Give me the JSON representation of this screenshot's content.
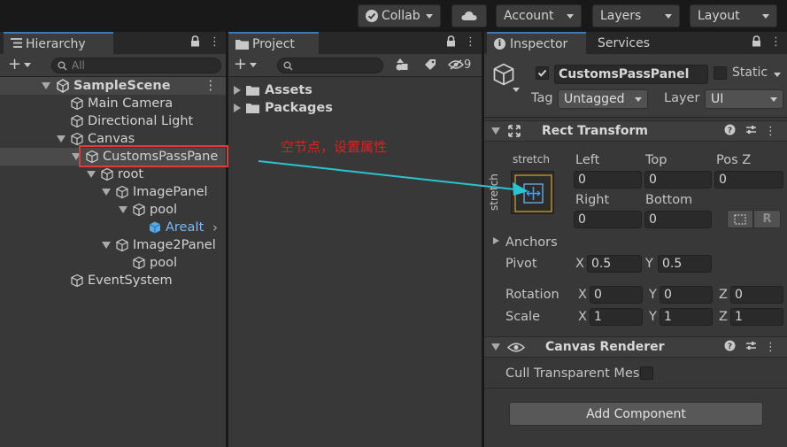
{
  "toolbar": {
    "collab_label": "Collab",
    "account_label": "Account",
    "layers_label": "Layers",
    "layout_label": "Layout"
  },
  "hierarchy": {
    "tab_label": "Hierarchy",
    "search_placeholder": "All",
    "scene_name": "SampleScene",
    "items": [
      {
        "label": "Main Camera"
      },
      {
        "label": "Directional Light"
      },
      {
        "label": "Canvas"
      },
      {
        "label": "CustomsPassPane"
      },
      {
        "label": "root"
      },
      {
        "label": "ImagePanel"
      },
      {
        "label": "pool"
      },
      {
        "label": "AreaIt"
      },
      {
        "label": "Image2Panel"
      },
      {
        "label": "pool"
      },
      {
        "label": "EventSystem"
      }
    ]
  },
  "project": {
    "tab_label": "Project",
    "hidden_count": "9",
    "folders": [
      {
        "label": "Assets"
      },
      {
        "label": "Packages"
      }
    ]
  },
  "annotation": {
    "text": "空节点，设置属性",
    "color": "#e02020"
  },
  "inspector": {
    "tab_label": "Inspector",
    "services_label": "Services",
    "object_name": "CustomsPassPanel",
    "static_label": "Static",
    "tag_label": "Tag",
    "tag_value": "Untagged",
    "layer_label": "Layer",
    "layer_value": "UI",
    "rect_transform": {
      "title": "Rect Transform",
      "stretch_top": "stretch",
      "stretch_side": "stretch",
      "left_label": "Left",
      "left_value": "0",
      "top_label": "Top",
      "top_value": "0",
      "posz_label": "Pos Z",
      "posz_value": "0",
      "right_label": "Right",
      "right_value": "0",
      "bottom_label": "Bottom",
      "bottom_value": "0",
      "anchors_label": "Anchors",
      "pivot_label": "Pivot",
      "pivot_x": "0.5",
      "pivot_y": "0.5",
      "rotation_label": "Rotation",
      "rot_x": "0",
      "rot_y": "0",
      "rot_z": "0",
      "scale_label": "Scale",
      "scale_x": "1",
      "scale_y": "1",
      "scale_z": "1",
      "x": "X",
      "y": "Y",
      "z": "Z",
      "r_button": "R"
    },
    "canvas_renderer": {
      "title": "Canvas Renderer",
      "cull_label": "Cull Transparent Mes"
    },
    "add_component_label": "Add Component"
  },
  "colors": {
    "highlight_box": "#e03a3a",
    "arrow": "#2bc3cf",
    "selected_text": "#7ab8f5",
    "accent": "#3a79bb"
  }
}
